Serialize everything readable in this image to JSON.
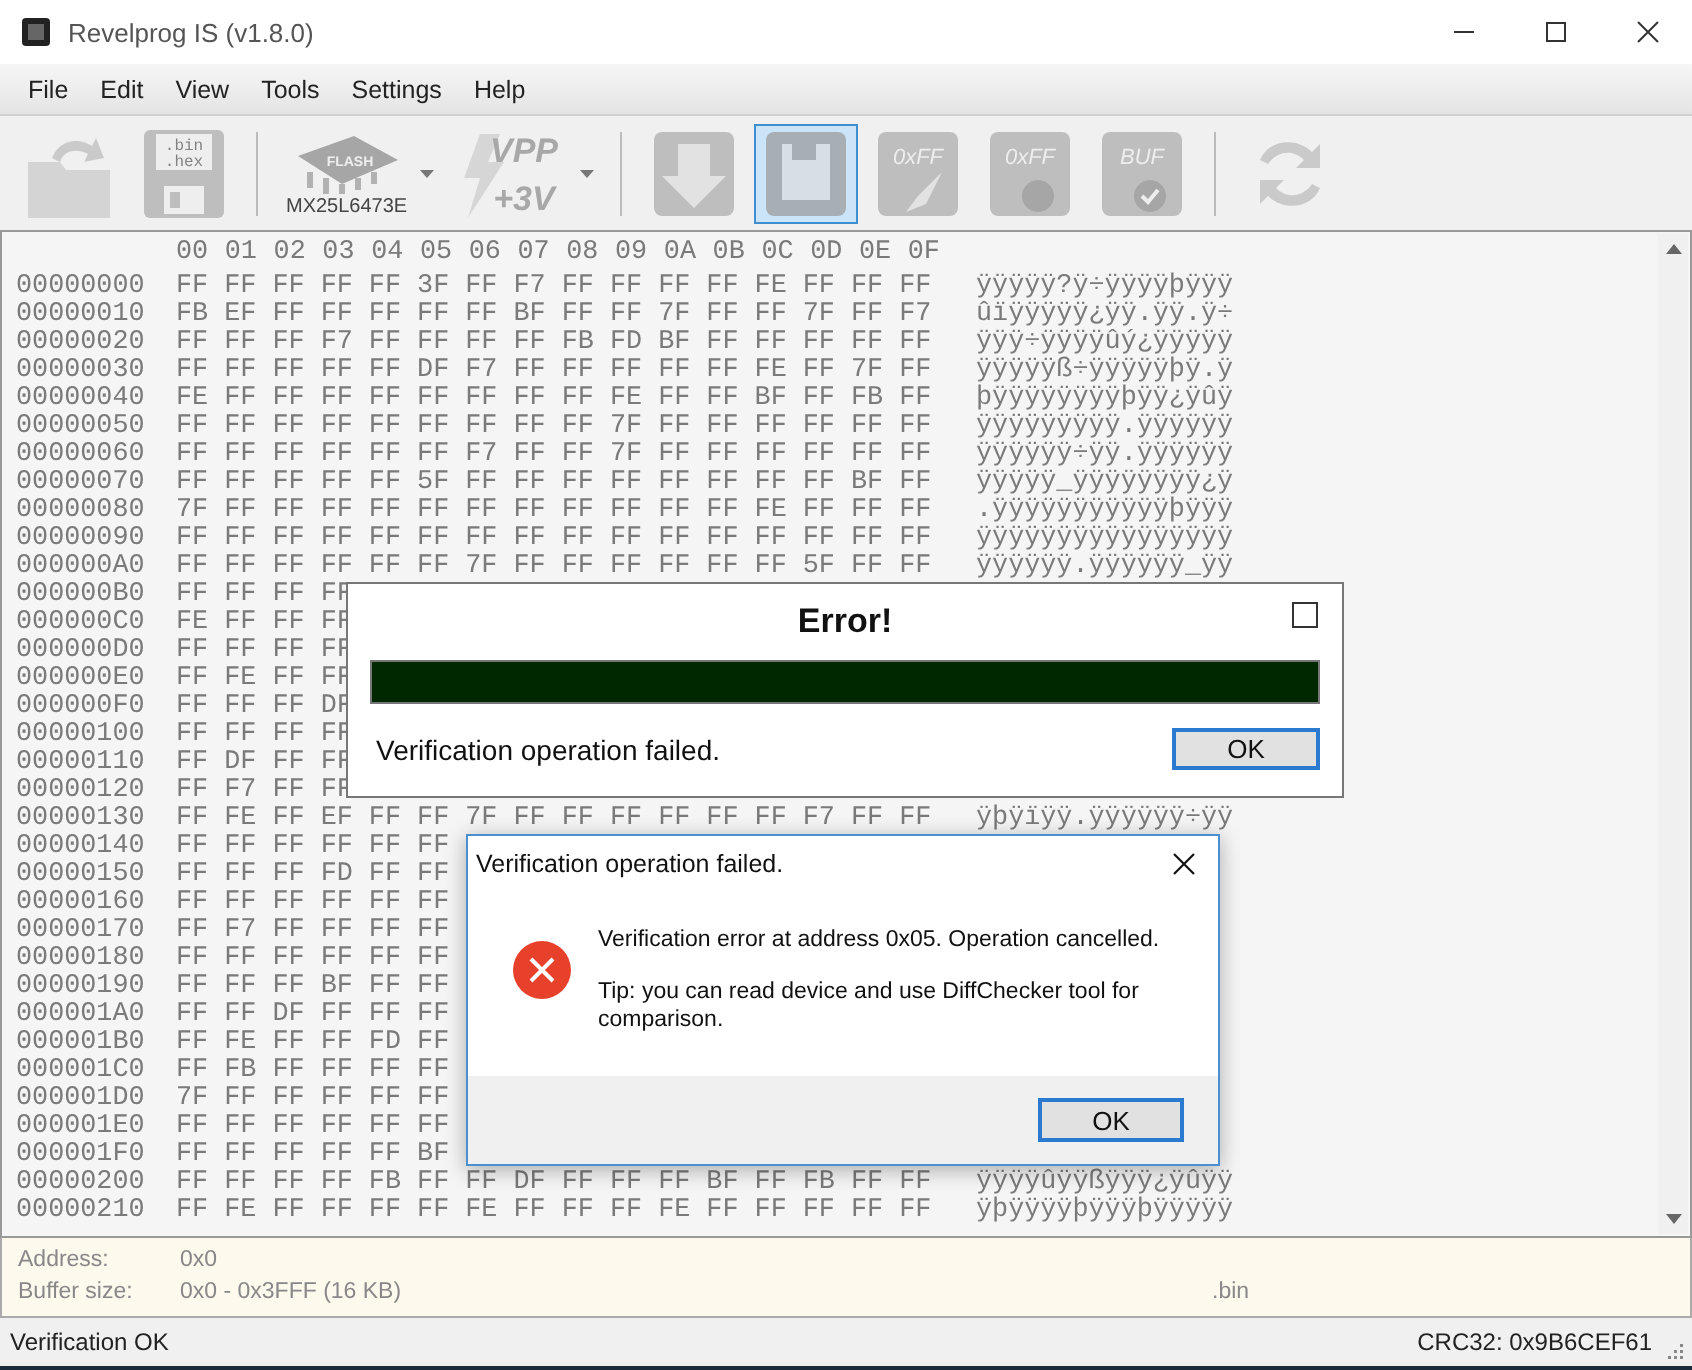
{
  "window": {
    "title": "Revelprog IS (v1.8.0)"
  },
  "menu": [
    "File",
    "Edit",
    "View",
    "Tools",
    "Settings",
    "Help"
  ],
  "toolbar": [
    {
      "kind": "open",
      "selected": false
    },
    {
      "kind": "save",
      "selected": false,
      "texts": [
        ".bin",
        ".hex"
      ]
    },
    {
      "kind": "separator"
    },
    {
      "kind": "chip",
      "selected": false,
      "texts": [
        "FLASH"
      ],
      "caption": "MX25L6473E",
      "dropdown": true
    },
    {
      "kind": "vpp",
      "selected": false,
      "texts": [
        "VPP",
        "+3V"
      ],
      "dropdown": true
    },
    {
      "kind": "separator"
    },
    {
      "kind": "read",
      "selected": false
    },
    {
      "kind": "write",
      "selected": true
    },
    {
      "kind": "erase",
      "selected": false,
      "texts": [
        "0xFF"
      ]
    },
    {
      "kind": "blank",
      "selected": false,
      "texts": [
        "0xFF"
      ]
    },
    {
      "kind": "verify",
      "selected": false,
      "texts": [
        "BUF"
      ]
    },
    {
      "kind": "separator"
    },
    {
      "kind": "convert",
      "selected": false
    }
  ],
  "hex": {
    "columns": [
      "00",
      "01",
      "02",
      "03",
      "04",
      "05",
      "06",
      "07",
      "08",
      "09",
      "0A",
      "0B",
      "0C",
      "0D",
      "0E",
      "0F"
    ],
    "rows": [
      {
        "address": "00000000",
        "bytes": "FF FF FF FF FF 3F FF F7 FF FF FF FF FE FF FF FF",
        "ascii": "ÿÿÿÿÿ?ÿ÷ÿÿÿÿþÿÿÿ"
      },
      {
        "address": "00000010",
        "bytes": "FB EF FF FF FF FF FF BF FF FF 7F FF FF 7F FF F7",
        "ascii": "ûïÿÿÿÿÿ¿ÿÿ.ÿÿ.ÿ÷"
      },
      {
        "address": "00000020",
        "bytes": "FF FF FF F7 FF FF FF FF FB FD BF FF FF FF FF FF",
        "ascii": "ÿÿÿ÷ÿÿÿÿûý¿ÿÿÿÿÿ"
      },
      {
        "address": "00000030",
        "bytes": "FF FF FF FF FF DF F7 FF FF FF FF FF FE FF 7F FF",
        "ascii": "ÿÿÿÿÿß÷ÿÿÿÿÿþÿ.ÿ"
      },
      {
        "address": "00000040",
        "bytes": "FE FF FF FF FF FF FF FF FF FE FF FF BF FF FB FF",
        "ascii": "þÿÿÿÿÿÿÿÿþÿÿ¿ÿûÿ"
      },
      {
        "address": "00000050",
        "bytes": "FF FF FF FF FF FF FF FF FF 7F FF FF FF FF FF FF",
        "ascii": "ÿÿÿÿÿÿÿÿÿ.ÿÿÿÿÿÿ"
      },
      {
        "address": "00000060",
        "bytes": "FF FF FF FF FF FF F7 FF FF 7F FF FF FF FF FF FF",
        "ascii": "ÿÿÿÿÿÿ÷ÿÿ.ÿÿÿÿÿÿ"
      },
      {
        "address": "00000070",
        "bytes": "FF FF FF FF FF 5F FF FF FF FF FF FF FF FF BF FF",
        "ascii": "ÿÿÿÿÿ_ÿÿÿÿÿÿÿÿ¿ÿ"
      },
      {
        "address": "00000080",
        "bytes": "7F FF FF FF FF FF FF FF FF FF FF FF FE FF FF FF",
        "ascii": ".ÿÿÿÿÿÿÿÿÿÿÿþÿÿÿ"
      },
      {
        "address": "00000090",
        "bytes": "FF FF FF FF FF FF FF FF FF FF FF FF FF FF FF FF",
        "ascii": "ÿÿÿÿÿÿÿÿÿÿÿÿÿÿÿÿ"
      },
      {
        "address": "000000A0",
        "bytes": "FF FF FF FF FF FF 7F FF FF FF FF FF FF 5F FF FF",
        "ascii": "ÿÿÿÿÿÿ.ÿÿÿÿÿÿ_ÿÿ"
      },
      {
        "address": "000000B0",
        "bytes": "FF FF FF FF"
      },
      {
        "address": "000000C0",
        "bytes": "FE FF FF FF"
      },
      {
        "address": "000000D0",
        "bytes": "FF FF FF FF"
      },
      {
        "address": "000000E0",
        "bytes": "FF FE FF FF"
      },
      {
        "address": "000000F0",
        "bytes": "FF FF FF DF"
      },
      {
        "address": "00000100",
        "bytes": "FF FF FF FF"
      },
      {
        "address": "00000110",
        "bytes": "FF DF FF FF"
      },
      {
        "address": "00000120",
        "bytes": "FF F7 FF FF"
      },
      {
        "address": "00000130",
        "bytes": "FF FE FF EF FF FF 7F FF FF FF FF FF FF F7 FF FF",
        "ascii": "ÿþÿïÿÿ.ÿÿÿÿÿÿ÷ÿÿ"
      },
      {
        "address": "00000140",
        "bytes": "FF FF FF FF FF FF"
      },
      {
        "address": "00000150",
        "bytes": "FF FF FF FD FF FF"
      },
      {
        "address": "00000160",
        "bytes": "FF FF FF FF FF FF"
      },
      {
        "address": "00000170",
        "bytes": "FF F7 FF FF FF FF"
      },
      {
        "address": "00000180",
        "bytes": "FF FF FF FF FF FF"
      },
      {
        "address": "00000190",
        "bytes": "FF FF FF BF FF FF"
      },
      {
        "address": "000001A0",
        "bytes": "FF FF DF FF FF FF"
      },
      {
        "address": "000001B0",
        "bytes": "FF FE FF FF FD FF"
      },
      {
        "address": "000001C0",
        "bytes": "FF FB FF FF FF FF"
      },
      {
        "address": "000001D0",
        "bytes": "7F FF FF FF FF FF"
      },
      {
        "address": "000001E0",
        "bytes": "FF FF FF FF FF FF"
      },
      {
        "address": "000001F0",
        "bytes": "FF FF FF FF FF BF"
      },
      {
        "address": "00000200",
        "bytes": "FF FF FF FF FB FF FF DF FF FF FF BF FF FB FF FF",
        "ascii": "ÿÿÿÿûÿÿßÿÿÿ¿ÿûÿÿ"
      },
      {
        "address": "00000210",
        "bytes": "FF FE FF FF FF FF FE FF FF FF FE FF FF FF FF FF",
        "ascii": "ÿþÿÿÿÿþÿÿÿþÿÿÿÿÿ"
      }
    ]
  },
  "info": {
    "address_label": "Address:",
    "address": "0x0",
    "size_label": "Buffer size:",
    "size": "0x0 - 0x3FFF (16 KB)",
    "extension": ".bin"
  },
  "status_bar": {
    "message": "Verification OK",
    "crc": "CRC32: 0x9B6CEF61"
  },
  "progress_dialog": {
    "title": "Error!",
    "level": 1,
    "message": "Verification operation failed.",
    "button": "OK"
  },
  "message_box": {
    "title": "Verification operation failed.",
    "kind": "error",
    "paragraphs": [
      "Verification error at address 0x05. Operation cancelled.",
      "Tip: you can read device and use DiffChecker tool for comparison."
    ],
    "button": "OK"
  }
}
